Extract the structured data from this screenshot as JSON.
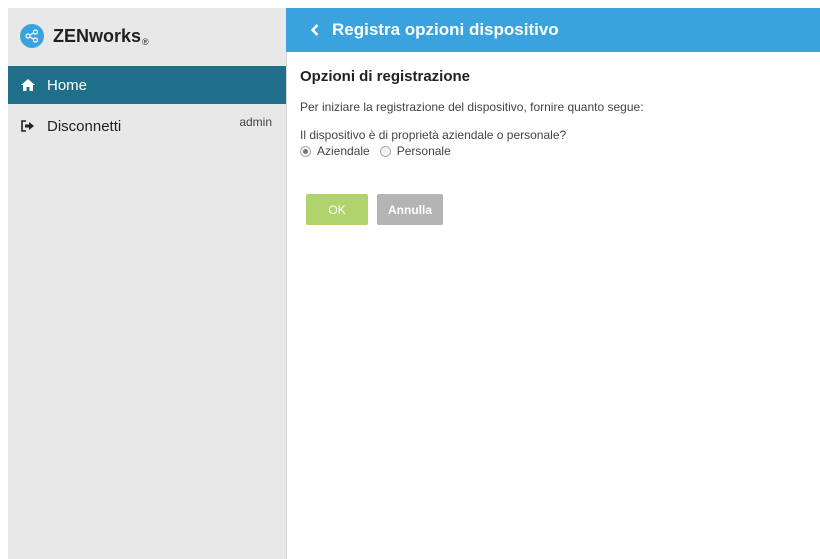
{
  "app": {
    "name": "ZENworks",
    "trademark": "®"
  },
  "sidebar": {
    "items": [
      {
        "label": "Home",
        "icon": "home-icon",
        "selected": true
      },
      {
        "label": "Disconnetti",
        "icon": "sign-out-icon",
        "user": "admin"
      }
    ]
  },
  "header": {
    "title": "Registra opzioni dispositivo",
    "back_icon": "chevron-left-icon"
  },
  "main": {
    "section_title": "Opzioni di registrazione",
    "intro": "Per iniziare la registrazione del dispositivo, fornire quanto segue:",
    "question": "Il dispositivo è di proprietà aziendale o personale?",
    "options": [
      {
        "label": "Aziendale",
        "selected": true
      },
      {
        "label": "Personale",
        "selected": false
      }
    ],
    "buttons": {
      "ok": "OK",
      "cancel": "Annulla"
    }
  },
  "colors": {
    "accent": "#3aa3dd",
    "nav_selected": "#1f6f8b",
    "ok_button": "#b1d36e",
    "cancel_button": "#b4b4b4",
    "sidebar_bg": "#e8e8e8"
  }
}
